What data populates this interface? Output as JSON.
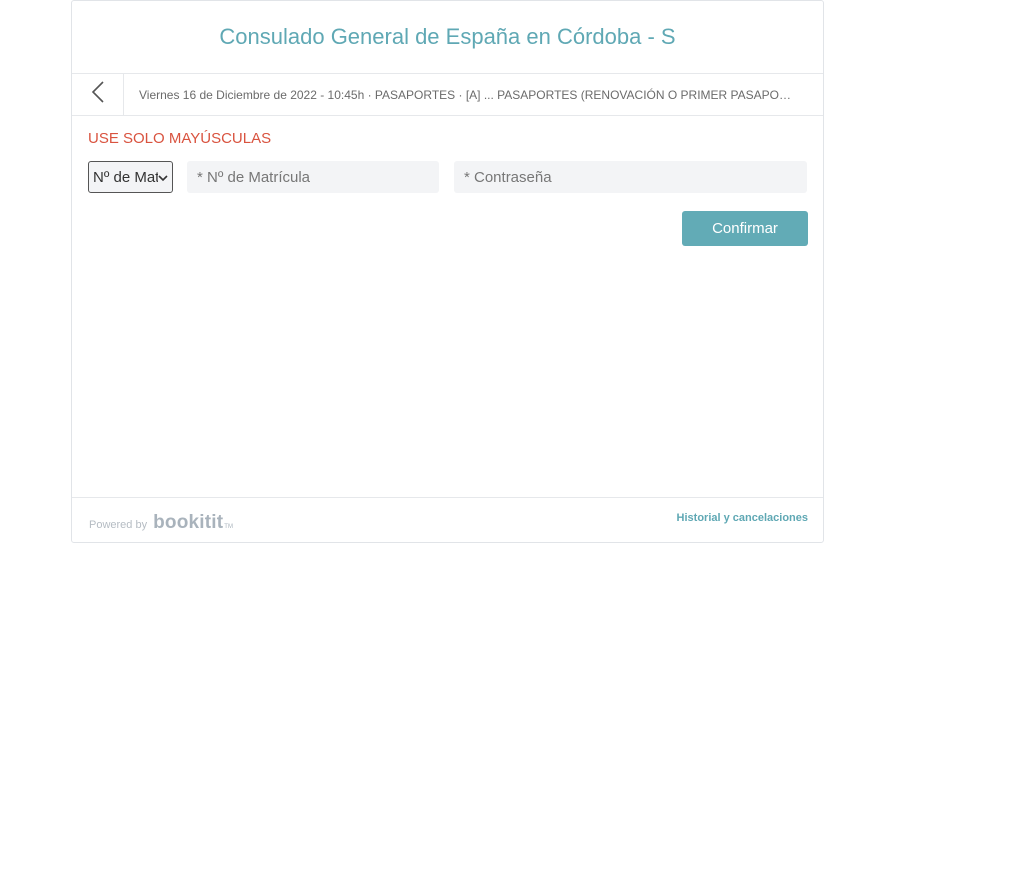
{
  "header": {
    "title": "Consulado General de España en Córdoba - S"
  },
  "breadcrumb": {
    "back_icon": "chevron-left-icon",
    "text": "Viernes 16 de Diciembre de 2022 - 10:45h · PASAPORTES · [A] ... PASAPORTES (RENOVACIÓN O PRIMER PASAPORTE)"
  },
  "form": {
    "warning": "USE SOLO MAYÚSCULAS",
    "id_type_select": {
      "selected": "Nº de Matrícula"
    },
    "matricula_placeholder": "* Nº de Matrícula",
    "password_placeholder": "* Contraseña",
    "confirm_label": "Confirmar"
  },
  "footer": {
    "powered_by": "Powered by",
    "brand": "bookitit",
    "brand_mark": "TM",
    "history_link": "Historial y cancelaciones"
  },
  "colors": {
    "accent": "#62abb6",
    "warning": "#d9533f"
  }
}
